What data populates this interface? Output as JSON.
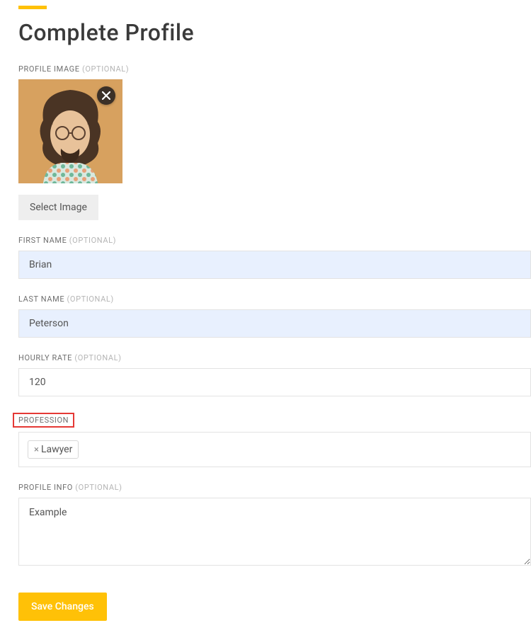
{
  "page": {
    "title": "Complete Profile"
  },
  "labels": {
    "profile_image": "PROFILE IMAGE",
    "first_name": "FIRST NAME",
    "last_name": "LAST NAME",
    "hourly_rate": "HOURLY RATE",
    "profession": "PROFESSION",
    "profile_info": "PROFILE INFO",
    "optional_suffix": "(OPTIONAL)"
  },
  "buttons": {
    "select_image": "Select Image",
    "save_changes": "Save Changes"
  },
  "values": {
    "first_name": "Brian",
    "last_name": "Peterson",
    "hourly_rate": "120",
    "profile_info": "Example"
  },
  "profession": {
    "tags": [
      {
        "label": "Lawyer"
      }
    ]
  }
}
